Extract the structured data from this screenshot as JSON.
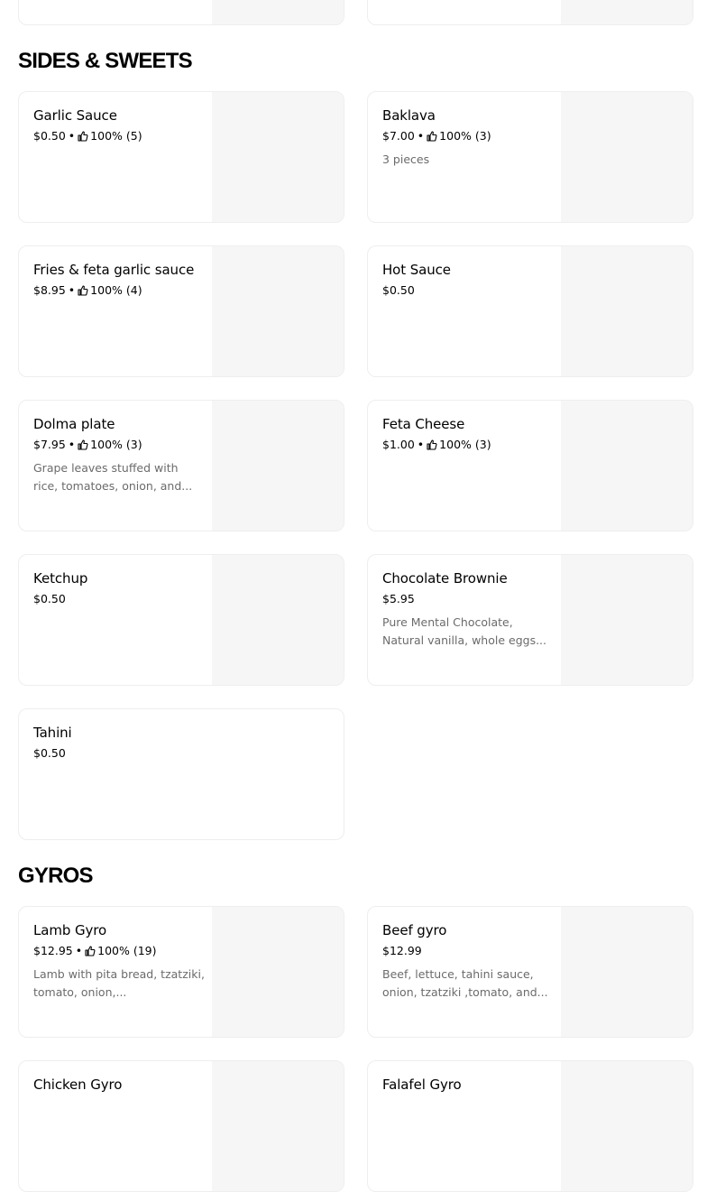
{
  "sections": [
    {
      "title": "SIDES & SWEETS",
      "items": [
        {
          "name": "Garlic Sauce",
          "price": "$0.50",
          "rating": "100% (5)",
          "description": ""
        },
        {
          "name": "Baklava",
          "price": "$7.00",
          "rating": "100% (3)",
          "description": "3 pieces"
        },
        {
          "name": "Fries & feta garlic sauce",
          "price": "$8.95",
          "rating": "100% (4)",
          "description": ""
        },
        {
          "name": "Hot Sauce",
          "price": "$0.50",
          "rating": "",
          "description": ""
        },
        {
          "name": "Dolma plate",
          "price": "$7.95",
          "rating": "100% (3)",
          "description": "Grape leaves stuffed with rice, tomatoes, onion, and..."
        },
        {
          "name": "Feta Cheese",
          "price": "$1.00",
          "rating": "100% (3)",
          "description": ""
        },
        {
          "name": "Ketchup",
          "price": "$0.50",
          "rating": "",
          "description": ""
        },
        {
          "name": "Chocolate Brownie",
          "price": "$5.95",
          "rating": "",
          "description": "Pure Mental Chocolate, Natural vanilla, whole eggs..."
        },
        {
          "name": "Tahini",
          "price": "$0.50",
          "rating": "",
          "description": ""
        }
      ]
    },
    {
      "title": "GYROS",
      "items": [
        {
          "name": "Lamb Gyro",
          "price": "$12.95",
          "rating": "100% (19)",
          "description": "Lamb with pita bread, tzatziki, tomato, onion,..."
        },
        {
          "name": "Beef gyro",
          "price": "$12.99",
          "rating": "",
          "description": "Beef, lettuce, tahini sauce, onion, tzatziki ,tomato, and..."
        },
        {
          "name": "Chicken Gyro",
          "price": "",
          "rating": "",
          "description": ""
        },
        {
          "name": "Falafel Gyro",
          "price": "",
          "rating": "",
          "description": ""
        }
      ]
    }
  ],
  "icons": {
    "rating": "thumbs-up-icon",
    "separator": "•"
  },
  "colors": {
    "card_border": "#eeeeee",
    "image_placeholder": "#f6f6f6",
    "description": "#6b6b6b"
  }
}
